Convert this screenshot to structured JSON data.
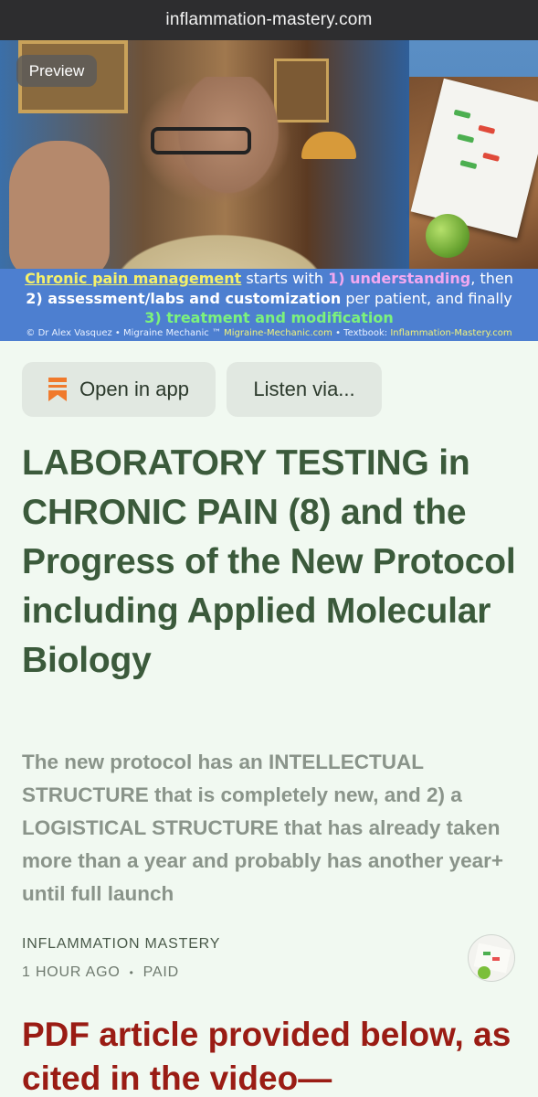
{
  "browser": {
    "url": "inflammation-mastery.com"
  },
  "hero": {
    "badge": "Preview",
    "caption": {
      "line1_a": "Chronic pain management",
      "line1_b": " starts with ",
      "line1_c": "1) understanding",
      "line1_d": ", then",
      "line2_a": "2) assessment/labs and customization",
      "line2_b": " per patient, and finally",
      "line3": "3) treatment and modification",
      "line4_a": "© Dr Alex Vasquez • Migraine Mechanic ™ ",
      "line4_b": "Migraine-Mechanic.com",
      "line4_c": " • Textbook: ",
      "line4_d": "Inflammation-Mastery.com"
    }
  },
  "actions": {
    "open_in_app": "Open in app",
    "listen": "Listen via..."
  },
  "article": {
    "title": "LABORATORY TESTING in CHRONIC PAIN (8) and the Progress of the New Protocol including Applied Molecular Biology",
    "subtitle": "The new protocol has an INTELLECTUAL STRUCTURE that is completely new, and 2) a LOGISTICAL STRUCTURE that has already taken more than a year and probably has another year+ until full launch",
    "publication": "INFLAMMATION MASTERY",
    "time": "1 HOUR AGO",
    "separator": "•",
    "access": "PAID",
    "headline": "PDF article provided below, as cited in the video—"
  },
  "colors": {
    "background": "#f1f9f1",
    "title": "#3b5a3b",
    "subtitle": "#8a948a",
    "headline": "#9a1c14",
    "bookmark": "#f07a2c"
  },
  "icons": {
    "open_in_app": "bookmark-icon"
  }
}
